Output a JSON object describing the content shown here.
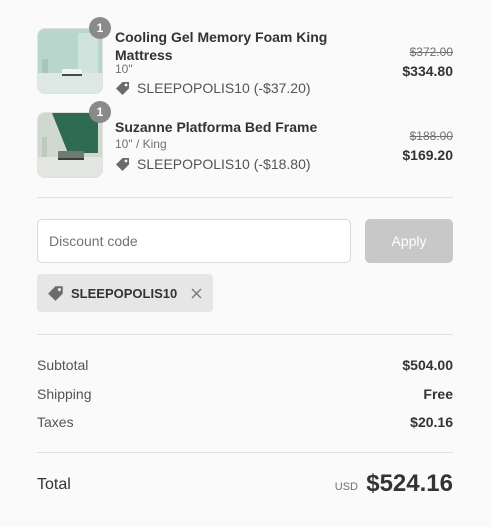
{
  "items": [
    {
      "quantity": "1",
      "name": "Cooling Gel Memory Foam King Mattress",
      "variant": "10\"",
      "discount_text": "SLEEPOPOLIS10 (-$37.20)",
      "original_price": "$372.00",
      "price": "$334.80",
      "thumb_icon": "mattress-photo",
      "thumb_colors": {
        "wall": "#b9d6cd",
        "floor": "#dde7e3",
        "accent": "#4e7266"
      }
    },
    {
      "quantity": "1",
      "name": "Suzanne Platforma Bed Frame",
      "variant": "10\" / King",
      "discount_text": "SLEEPOPOLIS10 (-$18.80)",
      "original_price": "$188.00",
      "price": "$169.20",
      "thumb_icon": "bed-frame-photo",
      "thumb_colors": {
        "wall": "#cfd9cf",
        "floor": "#e3e6e0",
        "accent": "#2f6b52"
      }
    }
  ],
  "discount": {
    "placeholder": "Discount code",
    "apply_label": "Apply",
    "applied_code": "SLEEPOPOLIS10",
    "remove_icon": "close-icon",
    "tag_icon": "tag-icon"
  },
  "summary": {
    "subtotal_label": "Subtotal",
    "subtotal_value": "$504.00",
    "shipping_label": "Shipping",
    "shipping_value": "Free",
    "taxes_label": "Taxes",
    "taxes_value": "$20.16"
  },
  "total": {
    "label": "Total",
    "currency": "USD",
    "value": "$524.16"
  }
}
